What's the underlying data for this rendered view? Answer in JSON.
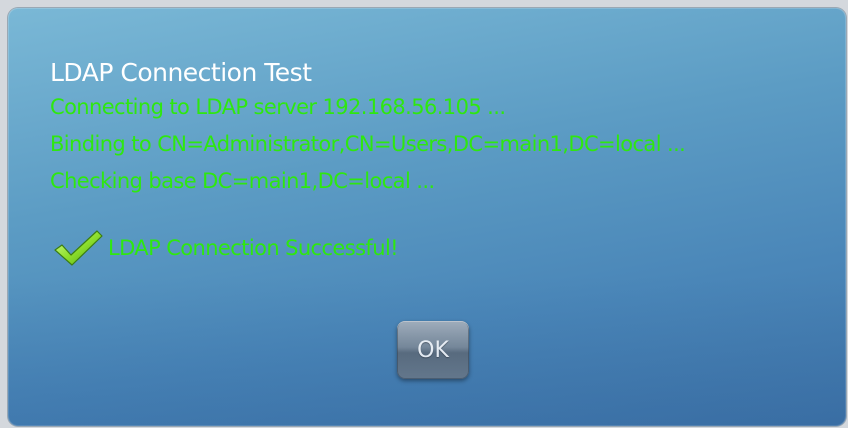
{
  "dialog": {
    "title": "LDAP Connection Test",
    "log_lines": [
      "Connecting to LDAP server 192.168.56.105 ...",
      "Binding to CN=Administrator,CN=Users,DC=main1,DC=local ...",
      "Checking base DC=main1,DC=local ..."
    ],
    "result": {
      "icon": "checkmark-icon",
      "text": "LDAP Connection Successful!"
    },
    "ok_label": "OK"
  },
  "colors": {
    "log_text": "#2ee80f",
    "title_text": "#ffffff",
    "dialog_background": "#5c9cc4"
  }
}
